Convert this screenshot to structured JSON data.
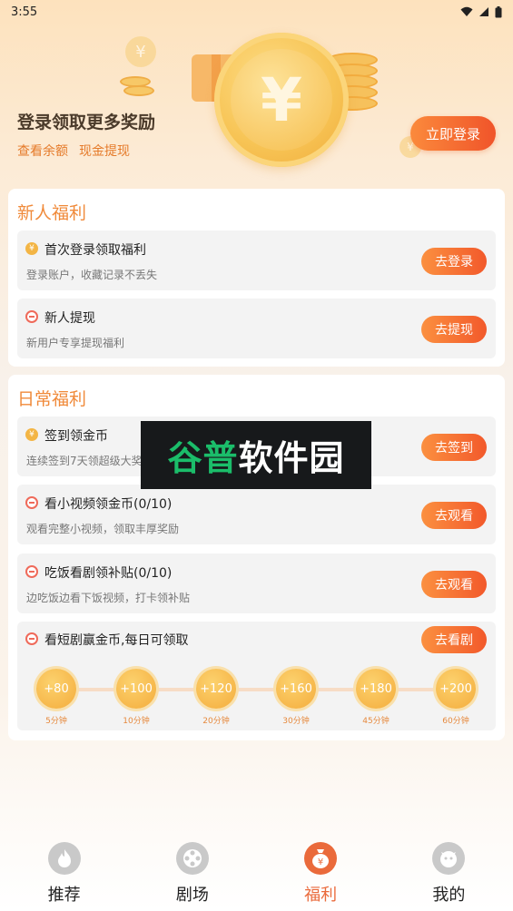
{
  "status_bar": {
    "time": "3:55"
  },
  "header": {
    "title": "登录领取更多奖励",
    "links": [
      "查看余额",
      "现金提现"
    ],
    "login_button": "立即登录",
    "coin_symbol": "¥"
  },
  "newbie": {
    "title": "新人福利",
    "tasks": [
      {
        "name": "首次登录领取福利",
        "desc": "登录账户，收藏记录不丢失",
        "button": "去登录",
        "icon": "coin-icon"
      },
      {
        "name": "新人提现",
        "desc": "新用户专享提现福利",
        "button": "去提现",
        "icon": "wallet-icon"
      }
    ]
  },
  "daily": {
    "title": "日常福利",
    "tasks": [
      {
        "name": "签到领金币",
        "desc": "连续签到7天领超级大奖",
        "button": "去签到",
        "icon": "coin-icon"
      },
      {
        "name": "看小视频领金币(0/10)",
        "desc": "观看完整小视频，领取丰厚奖励",
        "button": "去观看",
        "icon": "video-icon"
      },
      {
        "name": "吃饭看剧领补贴(0/10)",
        "desc": "边吃饭边看下饭视频，打卡领补贴",
        "button": "去观看",
        "icon": "meal-icon"
      }
    ],
    "drama": {
      "name": "看短剧赢金币,每日可领取",
      "button": "去看剧",
      "rewards": [
        {
          "amount": "+80",
          "time": "5分钟"
        },
        {
          "amount": "+100",
          "time": "10分钟"
        },
        {
          "amount": "+120",
          "time": "20分钟"
        },
        {
          "amount": "+160",
          "time": "30分钟"
        },
        {
          "amount": "+180",
          "time": "45分钟"
        },
        {
          "amount": "+200",
          "time": "60分钟"
        }
      ]
    }
  },
  "watermark": {
    "part1": "谷普",
    "part2": "软件园"
  },
  "tabbar": [
    {
      "label": "推荐",
      "icon": "flame-icon",
      "active": false
    },
    {
      "label": "剧场",
      "icon": "film-reel-icon",
      "active": false
    },
    {
      "label": "福利",
      "icon": "money-bag-icon",
      "active": true
    },
    {
      "label": "我的",
      "icon": "profile-face-icon",
      "active": false
    }
  ],
  "colors": {
    "accent": "#f2592b",
    "title_orange": "#f08a3a",
    "coin": "#f4ac3c"
  }
}
